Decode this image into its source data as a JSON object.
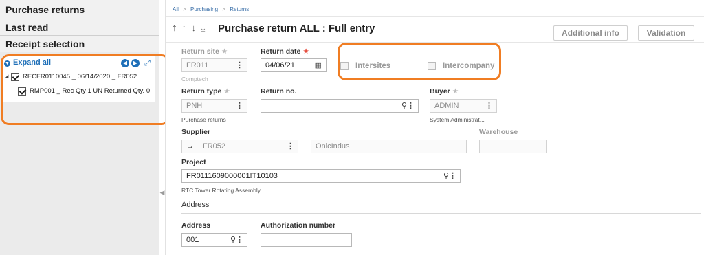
{
  "sidebar": {
    "sections": [
      "Purchase returns",
      "Last read",
      "Receipt selection"
    ],
    "tree": {
      "expand_all": "Expand all",
      "rows": [
        {
          "label": "RECFR0110045 _ 06/14/2020 _ FR052",
          "checked": true
        },
        {
          "label": "RMP001 _ Rec Qty 1 UN Returned Qty. 0",
          "checked": true
        }
      ]
    }
  },
  "breadcrumb": [
    "All",
    "Purchasing",
    "Returns"
  ],
  "header": {
    "title": "Purchase return ALL : Full entry",
    "sort_icons": "⤒ ↑ ↓ ⤓",
    "additional_info": "Additional info",
    "validation": "Validation"
  },
  "form": {
    "return_site": {
      "label": "Return site",
      "value": "FR011",
      "sub": "Comptech"
    },
    "return_date": {
      "label": "Return date",
      "value": "04/06/21"
    },
    "intersites": {
      "label": "Intersites",
      "checked": false
    },
    "intercompany": {
      "label": "Intercompany",
      "checked": false
    },
    "return_type": {
      "label": "Return type",
      "value": "PNH",
      "sub": "Purchase returns"
    },
    "return_no": {
      "label": "Return no.",
      "value": ""
    },
    "buyer": {
      "label": "Buyer",
      "value": "ADMIN",
      "sub": "System Administrat..."
    },
    "supplier": {
      "label": "Supplier",
      "value": "FR052",
      "name": "OnicIndus"
    },
    "warehouse": {
      "label": "Warehouse",
      "value": ""
    },
    "project": {
      "label": "Project",
      "value": "FR0111609000001!T10103",
      "sub": "RTC Tower Rotating Assembly"
    },
    "address_section": "Address",
    "address": {
      "label": "Address",
      "value": "001"
    },
    "authorization_number": {
      "label": "Authorization number",
      "value": ""
    }
  },
  "colors": {
    "accent": "#1e6fb8",
    "highlight": "#f07d23",
    "required": "#e64b3c"
  }
}
